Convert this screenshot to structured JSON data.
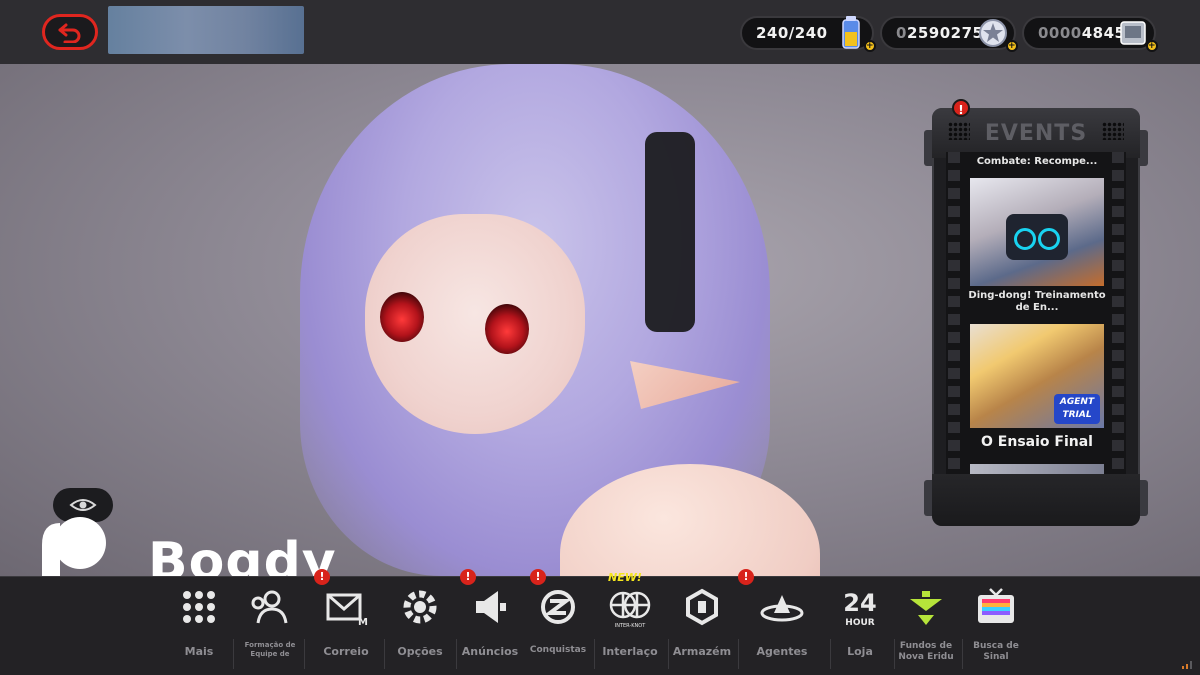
{
  "header": {
    "currencies": [
      {
        "value": "240/240",
        "icon": "battery-energy-icon"
      },
      {
        "prefix": "0",
        "value": "2590275",
        "icon": "denny-coin-icon"
      },
      {
        "prefix": "0000",
        "value": "4845",
        "icon": "film-master-tape-icon"
      }
    ]
  },
  "events": {
    "title": "EVENTS",
    "alert": "!",
    "items": [
      {
        "caption": "Combate: Recompe..."
      },
      {
        "caption": "Ding-dong! Treinamento de En..."
      },
      {
        "caption": "O Ensaio Final",
        "badge_line1": "AGENT",
        "badge_line2": "TRIAL"
      }
    ]
  },
  "player": {
    "name": "Bogdy"
  },
  "nav": {
    "items": [
      {
        "label": "Mais",
        "icon": "grid-more-icon"
      },
      {
        "label": "Formação de Equipe de",
        "icon": "team-formation-icon"
      },
      {
        "label": "Correio",
        "icon": "mail-icon",
        "alert": "!"
      },
      {
        "label": "Opções",
        "icon": "gear-icon"
      },
      {
        "label": "Anúncios",
        "icon": "megaphone-icon",
        "alert": "!"
      },
      {
        "label": "Conquistas",
        "icon": "achievements-icon",
        "alert": "!"
      },
      {
        "label": "Interlaço",
        "icon": "inter-knot-icon",
        "tag": "NEW!",
        "sublabel": "INTER-KNOT"
      },
      {
        "label": "Armazém",
        "icon": "storage-icon"
      },
      {
        "label": "Agentes",
        "icon": "agents-icon",
        "alert": "!"
      },
      {
        "label": "Loja",
        "icon": "24-hour-shop-icon",
        "icon_text_top": "24",
        "icon_text_bottom": "HOUR"
      },
      {
        "label": "Fundos de Nova Eridu",
        "icon": "eridu-fund-icon"
      },
      {
        "label": "Busca de Sinal",
        "icon": "signal-search-tv-icon"
      }
    ]
  },
  "colors": {
    "accent_red": "#d8231b",
    "gold": "#f5c21b",
    "new_yellow": "#f4e51d"
  }
}
